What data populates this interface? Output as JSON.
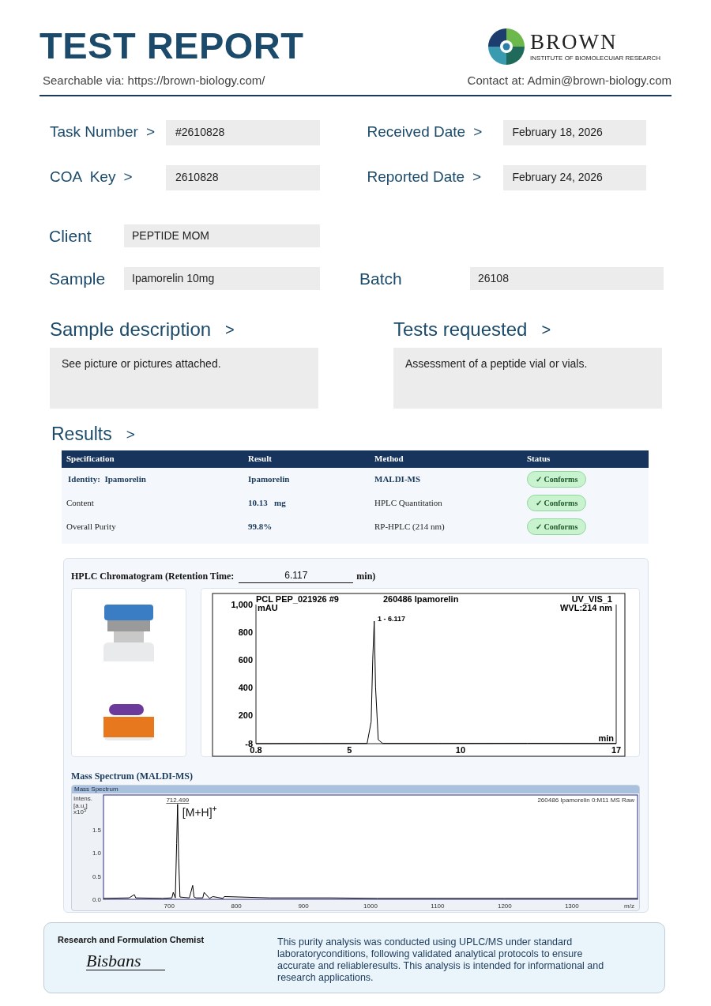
{
  "header": {
    "title": "TEST REPORT",
    "search_line": "Searchable via: https://brown-biology.com/",
    "contact": "Contact at: Admin@brown-biology.com",
    "logo_name": "BROWN",
    "logo_tagline": "INSTITUTE OF BIOMOLECUIAR RESEARCH"
  },
  "fields": [
    {
      "label": "Task Number",
      "arrow": ">",
      "value": "#2610828"
    },
    {
      "label": "Received Date",
      "arrow": ">",
      "value": "February 18, 2026"
    },
    {
      "label": "COA  Key",
      "arrow": ">",
      "value": "2610828"
    },
    {
      "label": "Reported Date",
      "arrow": ">",
      "value": "February 24, 2026"
    }
  ],
  "client": {
    "label": "Client",
    "value": "PEPTIDE MOM"
  },
  "sample": {
    "label": "Sample",
    "value": "Ipamorelin 10mg"
  },
  "batch": {
    "label": "Batch",
    "value": "26108"
  },
  "sections": [
    {
      "heading": "Sample description",
      "arrow": ">",
      "text": "See picture or pictures attached."
    },
    {
      "heading": "Tests requested",
      "arrow": ">",
      "text": "Assessment of a peptide vial or vials."
    }
  ],
  "results": {
    "heading": "Results",
    "arrow": ">",
    "columns": [
      "Specification",
      "Result",
      "Method",
      "Status"
    ],
    "rows": [
      {
        "kind": "identity",
        "cells": [
          "Identity:  Ipamorelin",
          "Ipamorelin",
          "MALDI-MS",
          "✓ Conforms"
        ]
      },
      {
        "kind": "measure",
        "cells": [
          "Content",
          "10.13   mg",
          "HPLC Quantitation",
          "✓ Conforms"
        ]
      },
      {
        "kind": "measure",
        "cells": [
          "Overall Purity",
          "99.8%",
          "RP-HPLC (214 nm)",
          "✓ Conforms"
        ]
      }
    ]
  },
  "hplc": {
    "title": "HPLC Chromatogram (Retention Time:",
    "retention_time": "6.117",
    "unit": "min)",
    "header_left": "PCL PEP_021926 #9",
    "header_mid": "260486 Ipamorelin",
    "header_right": "UV_VIS_1",
    "y_unit": "mAU",
    "wavelength": "WVL:214 nm",
    "peak_label": "1 - 6.117",
    "x_unit": "min",
    "chart_data": {
      "type": "line",
      "x": [
        0.8,
        3.0,
        5.8,
        5.98,
        6.05,
        6.117,
        6.18,
        6.3,
        6.5,
        9.0,
        13.0,
        17.0
      ],
      "series": [
        {
          "color": "#000000",
          "values": [
            -8,
            -7,
            -6,
            150,
            600,
            880,
            400,
            20,
            -6,
            -6,
            -5,
            -6
          ]
        }
      ],
      "xlim": [
        0.8,
        17.0
      ],
      "ylim": [
        -8,
        1000
      ],
      "xticks": [
        0.8,
        5.0,
        10.0,
        17.0
      ],
      "yticks": [
        {
          "value": -8,
          "label": "-8"
        },
        200,
        400,
        600,
        800,
        {
          "value": 1000,
          "label": "1,000"
        }
      ]
    }
  },
  "mass_spectrum": {
    "title": "Mass Spectrum (MALDI-MS)",
    "window_label": "Mass Spectrum",
    "y_label_1": "Intens.",
    "y_label_2": "[a.u.]",
    "y_label_3": "x10$^{5}$",
    "sample_label": "260486 Ipamorelin 0:M11 MS Raw",
    "peak_label": "712.499",
    "ion_label": "[M+H]$^{+}$",
    "x_unit": "m/z",
    "chart_data": {
      "type": "line",
      "x": [
        602,
        640,
        648,
        650,
        690,
        704,
        706,
        709,
        711,
        712.5,
        714,
        716,
        730,
        735,
        737,
        740,
        750,
        752,
        760,
        765,
        780,
        782,
        850,
        940,
        1010,
        1100,
        1200,
        1398
      ],
      "series": [
        {
          "color": "#000000",
          "values": [
            0.02,
            0.03,
            0.1,
            0.03,
            0.02,
            0.03,
            0.15,
            0.03,
            1.2,
            2.05,
            0.9,
            0.05,
            0.03,
            0.3,
            0.05,
            0.03,
            0.03,
            0.15,
            0.02,
            0.06,
            0.02,
            0.06,
            0.03,
            0.03,
            0.02,
            0.02,
            0.02,
            0.02
          ]
        }
      ],
      "xlim": [
        602,
        1398
      ],
      "ylim": [
        0,
        2.25
      ],
      "xticks": [
        700,
        800,
        900,
        1000,
        1100,
        1200,
        1300
      ],
      "yticks": [
        {
          "value": 0,
          "label": "0.0"
        },
        {
          "value": 0.5,
          "label": "0.5"
        },
        {
          "value": 1,
          "label": "1.0"
        },
        {
          "value": 1.5,
          "label": "1.5"
        }
      ]
    }
  },
  "footer": {
    "role": "Research and Formulation Chemist",
    "signature": "Bisbans",
    "note": "This purity analysis was conducted using UPLC/MS under standard laboratoryconditions, following validated analytical protocols to ensure accurate and reliableresults. This analysis is intended for informational and research applications."
  }
}
